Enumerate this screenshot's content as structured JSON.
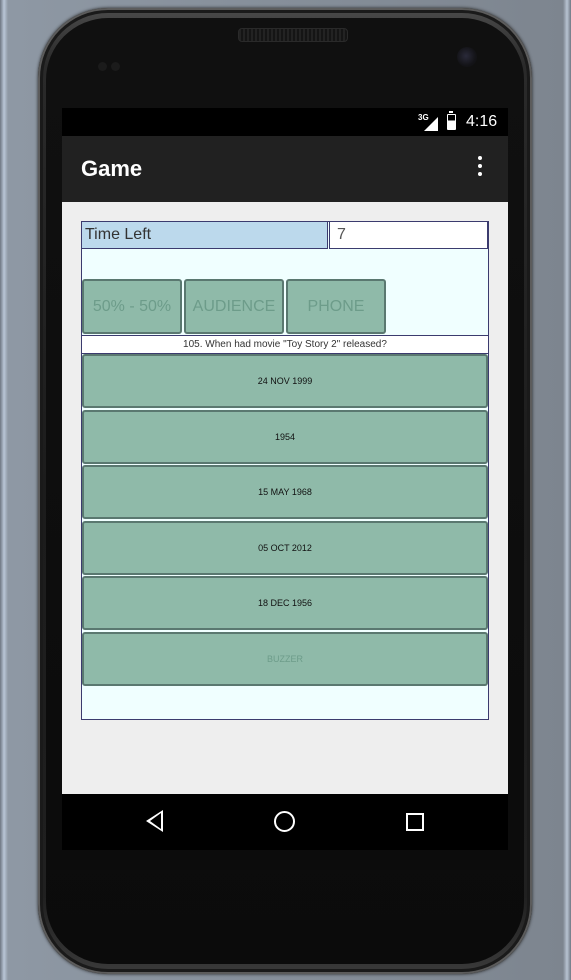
{
  "status_bar": {
    "network": "3G",
    "time": "4:16"
  },
  "action_bar": {
    "title": "Game",
    "overflow_icon": "more-vert-icon"
  },
  "timer": {
    "label": "Time Left",
    "value": "7"
  },
  "lifelines": [
    {
      "label": "50% - 50%"
    },
    {
      "label": "AUDIENCE"
    },
    {
      "label": "PHONE"
    }
  ],
  "question": "105. When had movie \"Toy Story 2\" released?",
  "answers": [
    {
      "label": "24 NOV 1999"
    },
    {
      "label": "1954"
    },
    {
      "label": "15 MAY 1968"
    },
    {
      "label": "05 OCT 2012"
    },
    {
      "label": "18 DEC 1956"
    }
  ],
  "buzzer": {
    "label": "BUZZER"
  },
  "nav_bar": {
    "back_icon": "back-icon",
    "home_icon": "home-icon",
    "recents_icon": "recents-icon"
  },
  "colors": {
    "button_fill": "#8fbaa9",
    "button_border": "#5a7870",
    "timer_label_bg": "#bcd9ec",
    "content_bg": "#f0ffff",
    "action_bar_bg": "#212121"
  }
}
